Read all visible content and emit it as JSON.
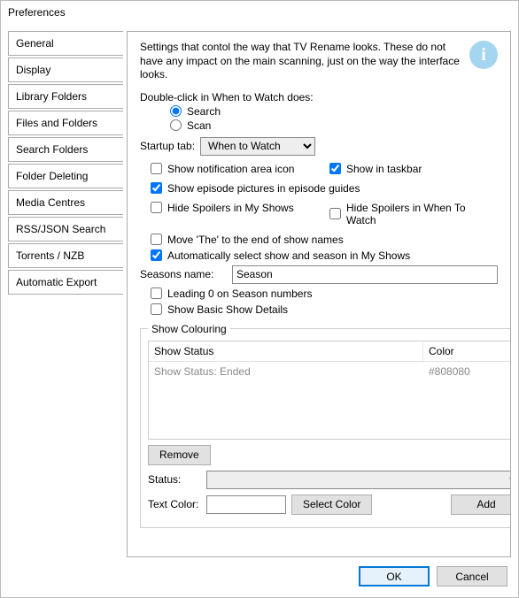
{
  "window": {
    "title": "Preferences"
  },
  "sidebar": {
    "items": [
      {
        "label": "General"
      },
      {
        "label": "Display"
      },
      {
        "label": "Library Folders"
      },
      {
        "label": "Files and Folders"
      },
      {
        "label": "Search Folders"
      },
      {
        "label": "Folder Deleting"
      },
      {
        "label": "Media Centres"
      },
      {
        "label": "RSS/JSON Search"
      },
      {
        "label": "Torrents / NZB"
      },
      {
        "label": "Automatic Export"
      }
    ]
  },
  "desc": "Settings that contol the way that TV Rename looks. These do not have any impact on the main scanning, just on the way the interface looks.",
  "dblclick": {
    "label": "Double-click in When to Watch does:",
    "opt_search": "Search",
    "opt_scan": "Scan"
  },
  "startup": {
    "label": "Startup tab:",
    "value": "When to Watch"
  },
  "checks": {
    "notif": "Show notification area icon",
    "taskbar": "Show in taskbar",
    "pictures": "Show episode pictures in episode guides",
    "hide_my": "Hide Spoilers in My Shows",
    "hide_wtw": "Hide Spoilers in When To Watch",
    "move_the": "Move 'The' to the end of show names",
    "auto_sel": "Automatically select show and season in My Shows",
    "leading0": "Leading 0 on Season numbers",
    "basic": "Show Basic Show Details"
  },
  "seasons": {
    "label": "Seasons name:",
    "value": "Season"
  },
  "colouring": {
    "legend": "Show Colouring",
    "col_status": "Show Status",
    "col_color": "Color",
    "rows": [
      {
        "status": "Show Status: Ended",
        "color": "#808080"
      }
    ],
    "remove": "Remove",
    "status_label": "Status:",
    "textcolor_label": "Text Color:",
    "textcolor_value": "",
    "select_color": "Select Color",
    "add": "Add"
  },
  "footer": {
    "ok": "OK",
    "cancel": "Cancel"
  }
}
